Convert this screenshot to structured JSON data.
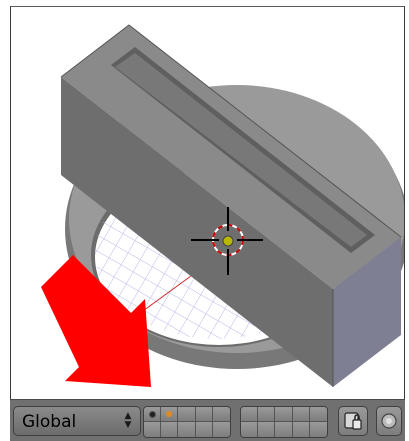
{
  "header": {
    "transform_orientation": "Global",
    "layers_group1": {
      "active_layers": [
        1
      ],
      "used_layers": [
        1,
        2
      ]
    },
    "colors": {
      "header_bg": "#707070",
      "arrow_red": "#ff0000",
      "object_gray": "#8e8e8e",
      "grid_blue": "#b8b8e8"
    }
  },
  "icons": {
    "lock": "lock-icon",
    "render": "render-icon"
  }
}
